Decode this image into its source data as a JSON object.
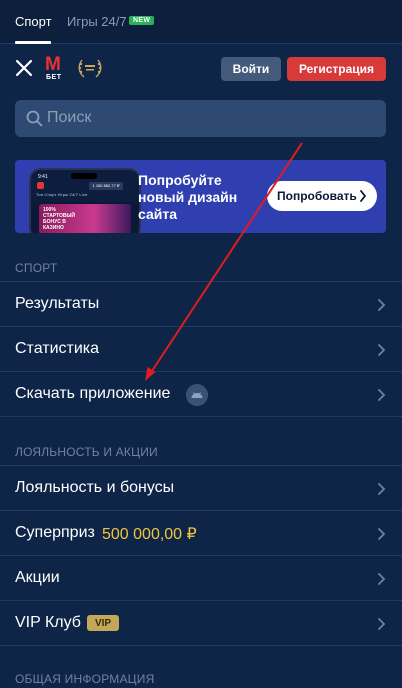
{
  "topnav": {
    "tab_sport": "Спорт",
    "tab_games": "Игры 24/7",
    "badge_new": "NEW"
  },
  "header": {
    "logo_letter": "M",
    "logo_text": "БЕТ",
    "login_label": "Войти",
    "register_label": "Регистрация"
  },
  "search": {
    "placeholder": "Поиск"
  },
  "promo": {
    "text": "Попробуйте новый дизайн сайта",
    "button_label": "Попробовать",
    "phone": {
      "time": "9:41",
      "amount": "1 150 862,77 ₽",
      "tabs": "Топ  Спорт  Игры 24/7  Live",
      "card_text": "100% СТАРТОВЫЙ БОНУС В КАЗИНО"
    }
  },
  "sections": {
    "sport_title": "СПОРТ",
    "loyalty_title": "ЛОЯЛЬНОСТЬ И АКЦИИ",
    "info_title": "ОБЩАЯ ИНФОРМАЦИЯ"
  },
  "menu": {
    "results": "Результаты",
    "statistics": "Статистика",
    "download_app": "Скачать приложение",
    "loyalty_bonuses": "Лояльность и бонусы",
    "superprize": "Суперприз",
    "superprize_value": "500 000,00 ₽",
    "promotions": "Акции",
    "vip_club": "VIP Клуб",
    "vip_badge": "VIP"
  },
  "colors": {
    "background": "#0f2548",
    "register": "#d83a3a",
    "login": "#445a7b",
    "promo_bg": "#2f3fb0",
    "prize_accent": "#f2c53d",
    "annotation_arrow": "#e01b22"
  }
}
